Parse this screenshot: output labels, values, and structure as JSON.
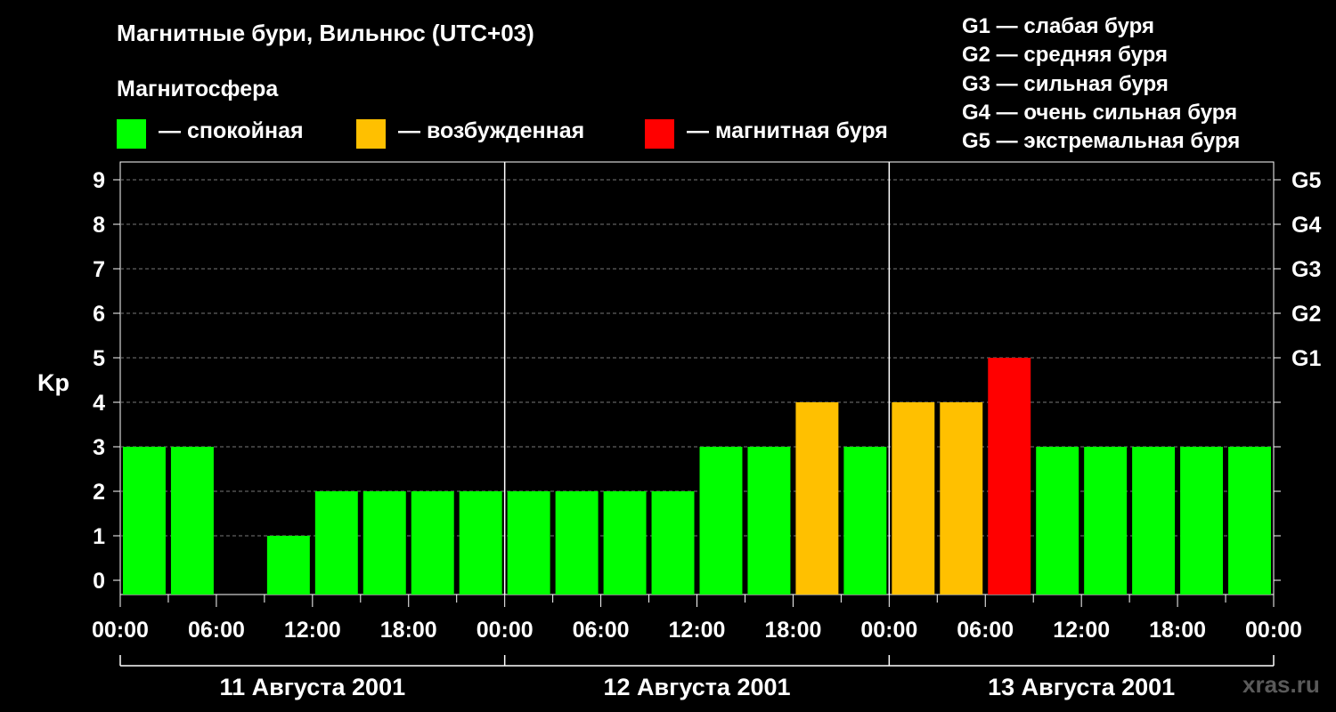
{
  "title": "Магнитные бури, Вильнюс (UTC+03)",
  "legend": {
    "heading": "Магнитосфера",
    "items": [
      {
        "label": "— спокойная",
        "color": "#00ff00"
      },
      {
        "label": "— возбужденная",
        "color": "#ffc000"
      },
      {
        "label": "— магнитная буря",
        "color": "#ff0000"
      }
    ]
  },
  "storm_scale": [
    "G1 — слабая буря",
    "G2 — средняя буря",
    "G3 — сильная буря",
    "G4 — очень сильная буря",
    "G5 — экстремальная буря"
  ],
  "watermark": "xras.ru",
  "chart_data": {
    "type": "bar",
    "ylabel": "Kp",
    "ylim": [
      0,
      9
    ],
    "y_ticks": [
      0,
      1,
      2,
      3,
      4,
      5,
      6,
      7,
      8,
      9
    ],
    "right_axis_labels": [
      {
        "value": 5,
        "label": "G1"
      },
      {
        "value": 6,
        "label": "G2"
      },
      {
        "value": 7,
        "label": "G3"
      },
      {
        "value": 8,
        "label": "G4"
      },
      {
        "value": 9,
        "label": "G5"
      }
    ],
    "x_tick_labels": [
      "00:00",
      "06:00",
      "12:00",
      "18:00",
      "00:00",
      "06:00",
      "12:00",
      "18:00",
      "00:00",
      "06:00",
      "12:00",
      "18:00",
      "00:00"
    ],
    "days": [
      "11 Августа 2001",
      "12 Августа 2001",
      "13 Августа 2001"
    ],
    "bar_interval_hours": 3,
    "values": [
      3,
      3,
      0,
      1,
      2,
      2,
      2,
      2,
      2,
      2,
      2,
      2,
      3,
      3,
      4,
      3,
      4,
      4,
      5,
      3,
      3,
      3,
      3,
      3
    ],
    "colors": {
      "quiet": "#00ff00",
      "active": "#ffc000",
      "storm": "#ff0000"
    },
    "grid": true
  }
}
